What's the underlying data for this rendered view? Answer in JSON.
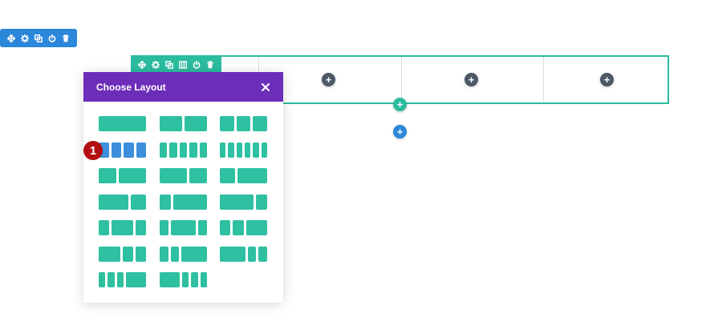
{
  "colors": {
    "section_blue": "#2b87da",
    "row_teal": "#2bbc9f",
    "modal_purple": "#6c2eb9",
    "module_dark": "#4c5866",
    "layout_teal": "#2ec0a1",
    "layout_selected_blue": "#3b8fdc",
    "badge_red": "#b40d12"
  },
  "section_toolbar": {
    "icons": [
      "move-icon",
      "gear-icon",
      "duplicate-icon",
      "power-icon",
      "trash-icon"
    ]
  },
  "row_toolbar": {
    "icons": [
      "move-icon",
      "gear-icon",
      "duplicate-icon",
      "columns-icon",
      "power-icon",
      "trash-icon"
    ]
  },
  "columns": [
    {
      "add_module_label": "+"
    },
    {
      "add_module_label": "+"
    },
    {
      "add_module_label": "+"
    }
  ],
  "add_row_label": "+",
  "add_section_label": "+",
  "modal": {
    "title": "Choose Layout",
    "close_icon": "close-icon",
    "layouts": [
      {
        "id": "1",
        "parts": [
          1
        ]
      },
      {
        "id": "1/2,1/2",
        "parts": [
          1,
          1
        ]
      },
      {
        "id": "1/3x3",
        "parts": [
          1,
          1,
          1
        ]
      },
      {
        "id": "1/4x4",
        "parts": [
          1,
          1,
          1,
          1
        ],
        "selected": true
      },
      {
        "id": "1/5x5",
        "parts": [
          1,
          1,
          1,
          1,
          1
        ]
      },
      {
        "id": "1/6x6",
        "parts": [
          1,
          1,
          1,
          1,
          1,
          1
        ]
      },
      {
        "id": "2/5,3/5",
        "parts": [
          2,
          3
        ]
      },
      {
        "id": "3/5,2/5",
        "parts": [
          3,
          2
        ]
      },
      {
        "id": "1/3,2/3",
        "parts": [
          1,
          2
        ]
      },
      {
        "id": "2/3,1/3",
        "parts": [
          2,
          1
        ]
      },
      {
        "id": "1/4,3/4",
        "parts": [
          1,
          3
        ]
      },
      {
        "id": "3/4,1/4",
        "parts": [
          3,
          1
        ]
      },
      {
        "id": "1/4,1/2,1/4",
        "parts": [
          1,
          2,
          1
        ]
      },
      {
        "id": "1/5,3/5,1/5",
        "parts": [
          1,
          3,
          1
        ]
      },
      {
        "id": "1/4,1/4,1/2",
        "parts": [
          1,
          1,
          2
        ]
      },
      {
        "id": "1/2,1/4,1/4",
        "parts": [
          2,
          1,
          1
        ]
      },
      {
        "id": "1/5,1/5,3/5",
        "parts": [
          1,
          1,
          3
        ]
      },
      {
        "id": "3/5,1/5,1/5",
        "parts": [
          3,
          1,
          1
        ]
      },
      {
        "id": "1/6,1/6,1/6,1/2",
        "parts": [
          1,
          1,
          1,
          3
        ]
      },
      {
        "id": "1/2,1/6,1/6,1/6",
        "parts": [
          3,
          1,
          1,
          1
        ]
      }
    ]
  },
  "step_badge": "1"
}
